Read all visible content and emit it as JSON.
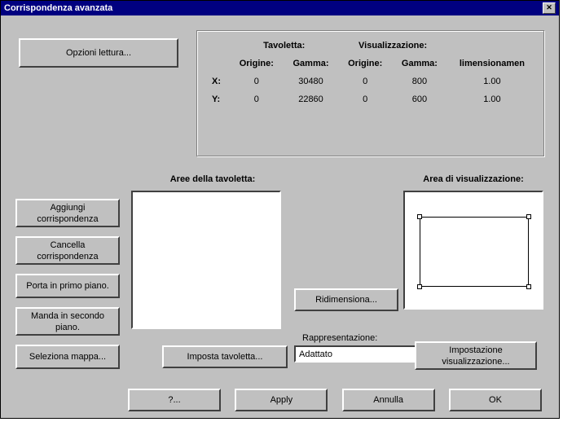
{
  "title": "Corrispondenza avanzata",
  "opzioni_lettura": "Opzioni lettura...",
  "info": {
    "tavoletta_header": "Tavoletta:",
    "visual_header": "Visualizzazione:",
    "col_origine": "Origine:",
    "col_gamma": "Gamma:",
    "col_dimension": "limensionamen",
    "row_x": "X:",
    "row_y": "Y:",
    "x": {
      "tav_origine": "0",
      "tav_gamma": "30480",
      "viz_origine": "0",
      "viz_gamma": "800",
      "dim": "1.00"
    },
    "y": {
      "tav_origine": "0",
      "tav_gamma": "22860",
      "viz_origine": "0",
      "viz_gamma": "600",
      "dim": "1.00"
    }
  },
  "aree_label": "Aree della tavoletta:",
  "area_viz_label": "Area di visualizzazione:",
  "side_buttons": {
    "aggiungi": "Aggiungi\ncorrispondenza",
    "cancella": "Cancella\ncorrispondenza",
    "porta": "Porta in primo piano.",
    "manda": "Manda in secondo\npiano.",
    "seleziona": "Seleziona mappa..."
  },
  "ridimensiona": "Ridimensiona...",
  "rappresentazione_label": "Rappresentazione:",
  "rappresentazione_value": "Adattato",
  "imposta_tavoletta": "Imposta tavoletta...",
  "impostazione_viz": "Impostazione\nvisualizzazione...",
  "bottom": {
    "help": "?...",
    "apply": "Apply",
    "annulla": "Annulla",
    "ok": "OK"
  }
}
